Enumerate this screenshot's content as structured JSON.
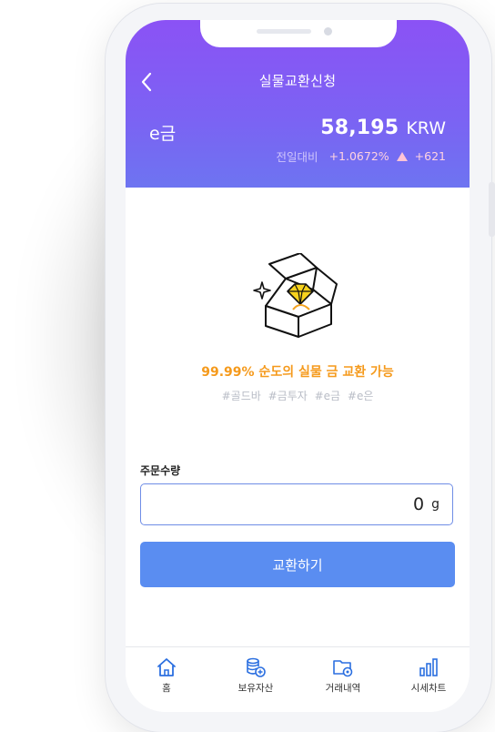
{
  "header": {
    "title": "실물교환신청",
    "asset_name": "e금",
    "price": "58,195",
    "currency": "KRW",
    "change_label": "전일대비",
    "change_percent": "+1.0672%",
    "change_amount": "+621",
    "accent_color": "#8b52f5"
  },
  "main": {
    "tagline": "99.99% 순도의 실물 금 교환 가능",
    "tags": "#골드바 #금투자 #e금 #e은",
    "quantity_label": "주문수량",
    "quantity_value": "0",
    "quantity_unit": "g",
    "submit_label": "교환하기",
    "button_color": "#5a8df1"
  },
  "bottom_nav": {
    "items": [
      {
        "label": "홈",
        "icon": "home-icon"
      },
      {
        "label": "보유자산",
        "icon": "coins-icon"
      },
      {
        "label": "거래내역",
        "icon": "folder-gear-icon"
      },
      {
        "label": "시세차트",
        "icon": "bar-chart-icon"
      }
    ]
  }
}
